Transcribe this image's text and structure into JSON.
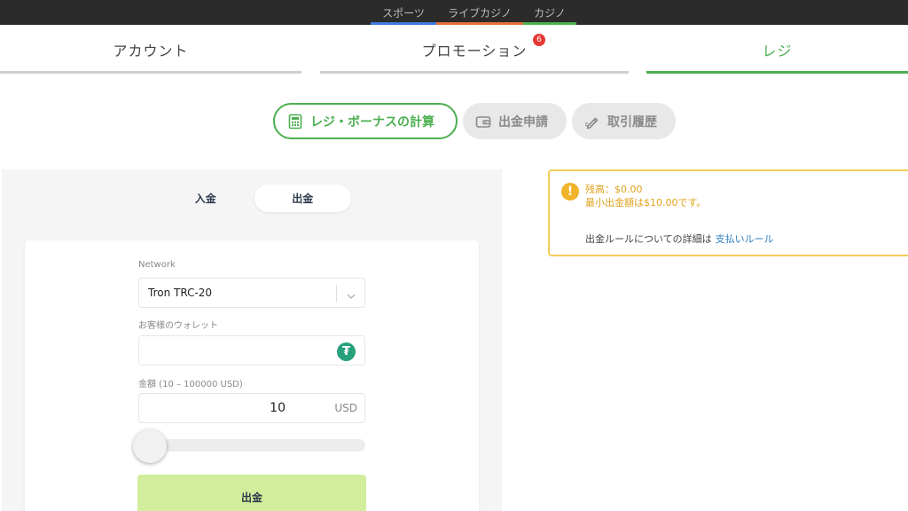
{
  "top_nav": [
    {
      "label": "スポーツ",
      "color": "#3d7be0"
    },
    {
      "label": "ライブカジノ",
      "color": "#e2703a"
    },
    {
      "label": "カジノ",
      "color": "#4caf50"
    }
  ],
  "tabs": {
    "account": "アカウント",
    "promotion": "プロモーション",
    "promotion_badge": "6",
    "cashier": "レジ"
  },
  "actions": {
    "bonus_calc": "レジ・ボーナスの計算",
    "withdraw_request": "出金申請",
    "history": "取引履歴"
  },
  "mode": {
    "deposit": "入金",
    "withdraw": "出金",
    "selected": "withdraw"
  },
  "form": {
    "network_label": "Network",
    "network_value": "Tron TRC-20",
    "wallet_label": "お客様のウォレット",
    "wallet_value": "",
    "amount_label": "金額 (10 – 100000 USD)",
    "amount_value": "10",
    "currency": "USD",
    "slider_fraction": 0,
    "submit_label": "出金"
  },
  "info": {
    "balance": "残高：$0.00",
    "min_withdraw": "最小出金額は$10.00です。",
    "rules_text": "出金ルールについての詳細は",
    "rules_link": "支払いルール"
  },
  "colors": {
    "accent": "#4caf50",
    "warning": "#f2cc5a",
    "submit_bg": "#d2ee9c"
  }
}
